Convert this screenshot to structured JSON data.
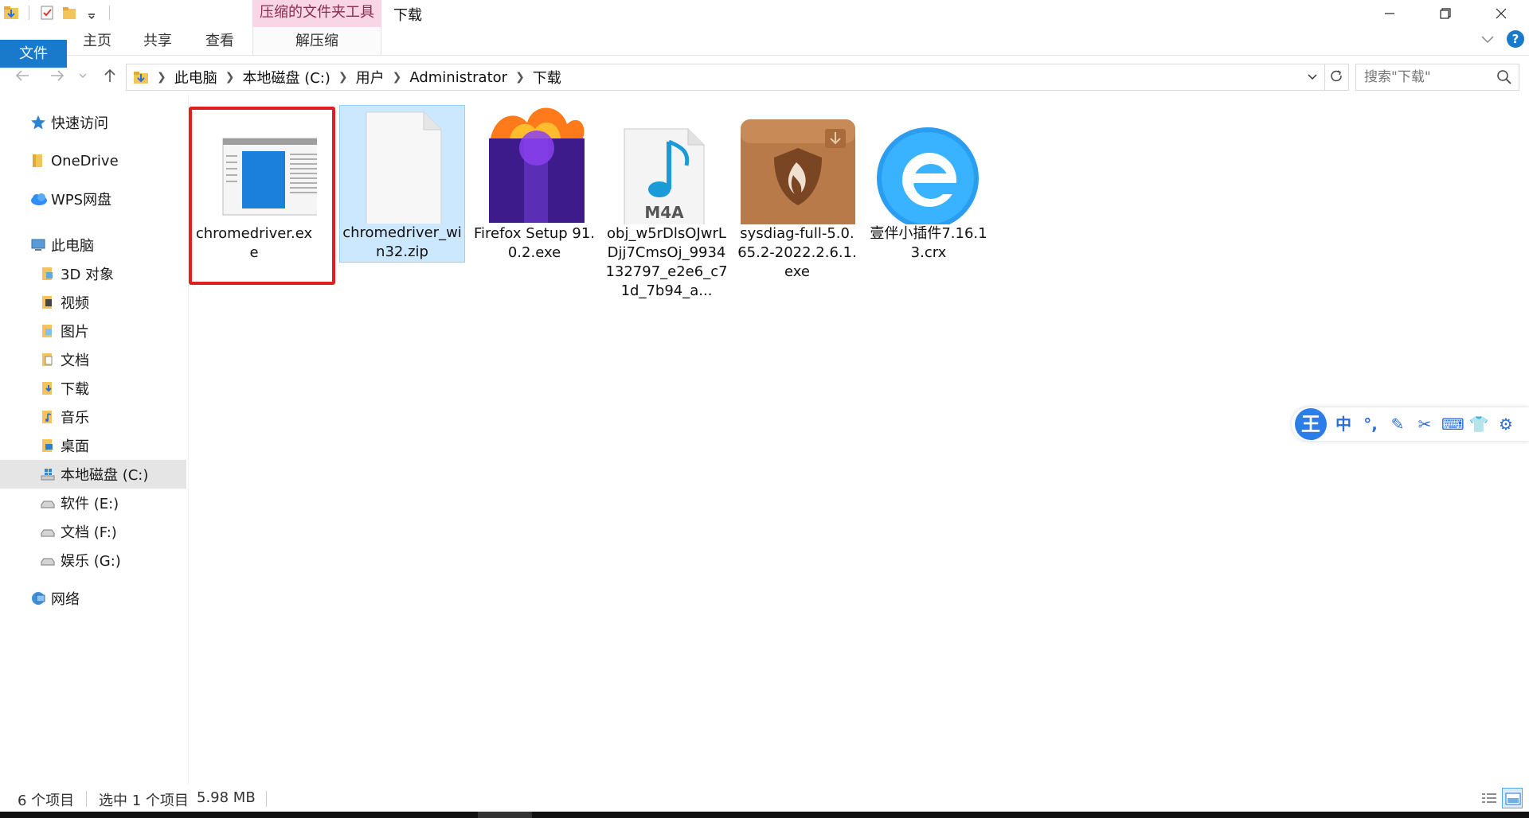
{
  "window": {
    "title": "下载",
    "context_tab": "压缩的文件夹工具",
    "controls": {
      "minimize": "—",
      "maximize": "❐",
      "close": "✕"
    }
  },
  "ribbon": {
    "tabs": [
      "文件",
      "主页",
      "共享",
      "查看"
    ],
    "context_tab": "解压缩",
    "help": "?"
  },
  "address": {
    "breadcrumbs": [
      "此电脑",
      "本地磁盘 (C:)",
      "用户",
      "Administrator",
      "下载"
    ],
    "search_placeholder": "搜索\"下载\""
  },
  "sidebar": {
    "items": [
      {
        "label": "快速访问",
        "icon": "star-icon"
      },
      {
        "label": "OneDrive",
        "icon": "folder-icon"
      },
      {
        "label": "WPS网盘",
        "icon": "cloud-icon"
      },
      {
        "label": "此电脑",
        "icon": "computer-icon"
      },
      {
        "label": "3D 对象",
        "icon": "folder-3d-icon"
      },
      {
        "label": "视频",
        "icon": "folder-video-icon"
      },
      {
        "label": "图片",
        "icon": "folder-pictures-icon"
      },
      {
        "label": "文档",
        "icon": "folder-documents-icon"
      },
      {
        "label": "下载",
        "icon": "folder-downloads-icon"
      },
      {
        "label": "音乐",
        "icon": "folder-music-icon"
      },
      {
        "label": "桌面",
        "icon": "folder-desktop-icon"
      },
      {
        "label": "本地磁盘 (C:)",
        "icon": "windows-drive-icon"
      },
      {
        "label": "软件 (E:)",
        "icon": "drive-icon"
      },
      {
        "label": "文档 (F:)",
        "icon": "drive-icon"
      },
      {
        "label": "娱乐 (G:)",
        "icon": "drive-icon"
      },
      {
        "label": "网络",
        "icon": "network-icon"
      }
    ]
  },
  "files": [
    {
      "name": "chromedriver.exe",
      "icon": "exe-window-icon"
    },
    {
      "name": "chromedriver_win32.zip",
      "icon": "blank-file-icon"
    },
    {
      "name": "Firefox Setup 91.0.2.exe",
      "icon": "firefox-icon"
    },
    {
      "name": "obj_w5rDlsOJwrLDjj7CmsOj_9934132797_e2e6_c71d_7b94_a...",
      "icon": "m4a-icon",
      "badge": "M4A"
    },
    {
      "name": "sysdiag-full-5.0.65.2-2022.2.6.1.exe",
      "icon": "sysdiag-box-icon"
    },
    {
      "name": "壹伴小插件7.16.13.crx",
      "icon": "ie-e-icon"
    }
  ],
  "ime": {
    "logo": "王",
    "items": [
      "中",
      "°,",
      "✎",
      "✂",
      "⌨",
      "👕",
      "⚙"
    ]
  },
  "status": {
    "count": "6 个项目",
    "selected": "选中 1 个项目",
    "size": "5.98 MB"
  }
}
